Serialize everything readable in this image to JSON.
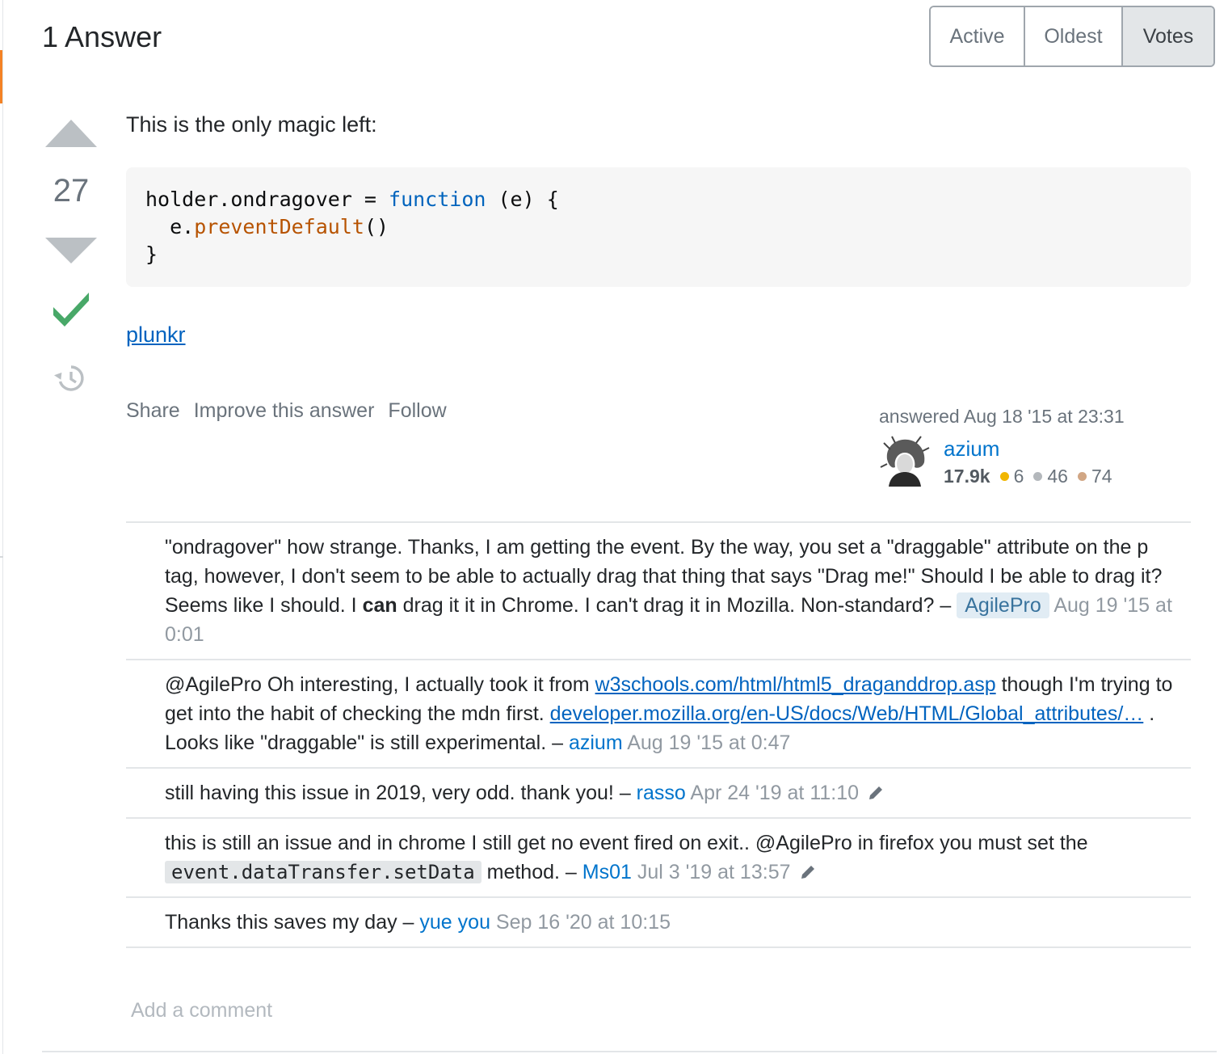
{
  "header": {
    "title": "1 Answer",
    "sort_tabs": [
      {
        "label": "Active",
        "active": false
      },
      {
        "label": "Oldest",
        "active": false
      },
      {
        "label": "Votes",
        "active": true
      }
    ]
  },
  "answer": {
    "vote_count": "27",
    "accepted": true,
    "intro": "This is the only magic left:",
    "code": {
      "line1_a": "holder.ondragover = ",
      "line1_kw": "function",
      "line1_b": " (e) {",
      "line2_a": "  e.",
      "line2_fn": "preventDefault",
      "line2_b": "()",
      "line3": "}"
    },
    "link_label": "plunkr",
    "menu": {
      "share": "Share",
      "improve": "Improve this answer",
      "follow": "Follow"
    },
    "user": {
      "action": "answered Aug 18 '15 at 23:31",
      "name": "azium",
      "reputation": "17.9k",
      "gold": "6",
      "silver": "46",
      "bronze": "74",
      "gold_color": "#f1b600",
      "silver_color": "#b4b8bc",
      "bronze_color": "#d1a684"
    }
  },
  "comments": [
    {
      "text_a": "\"ondragover\" how strange. Thanks, I am getting the event. By the way, you set a \"draggable\" attribute on the p tag, however, I don't seem to be able to actually drag that thing that says \"Drag me!\" Should I be able to drag it? Seems like I should. I ",
      "bold": "can",
      "text_b": " drag it it in Chrome. I can't drag it in Mozilla. Non-standard? – ",
      "user": "AgilePro",
      "date": "Aug 19 '15 at 0:01"
    },
    {
      "text_a": "@AgilePro Oh interesting, I actually took it from ",
      "link1": "w3schools.com/html/html5_draganddrop.asp",
      "text_b": " though I'm trying to get into the habit of checking the mdn first. ",
      "link2": "developer.mozilla.org/en-US/docs/Web/HTML/Global_attributes/…",
      "text_c": " . Looks like \"draggable\" is still experimental. – ",
      "user": "azium",
      "date": "Aug 19 '15 at 0:47"
    },
    {
      "text": "still having this issue in 2019, very odd. thank you! – ",
      "user": "rasso",
      "date": "Apr 24 '19 at 11:10"
    },
    {
      "text_a": "this is still an issue and in chrome I still get no event fired on exit.. @AgilePro in firefox you must set the ",
      "code": "event.dataTransfer.setData",
      "text_b": " method. – ",
      "user": "Ms01",
      "date": "Jul 3 '19 at 13:57"
    },
    {
      "text": "Thanks this saves my day – ",
      "user": "yue you",
      "date": "Sep 16 '20 at 10:15"
    }
  ],
  "add_comment": "Add a comment"
}
